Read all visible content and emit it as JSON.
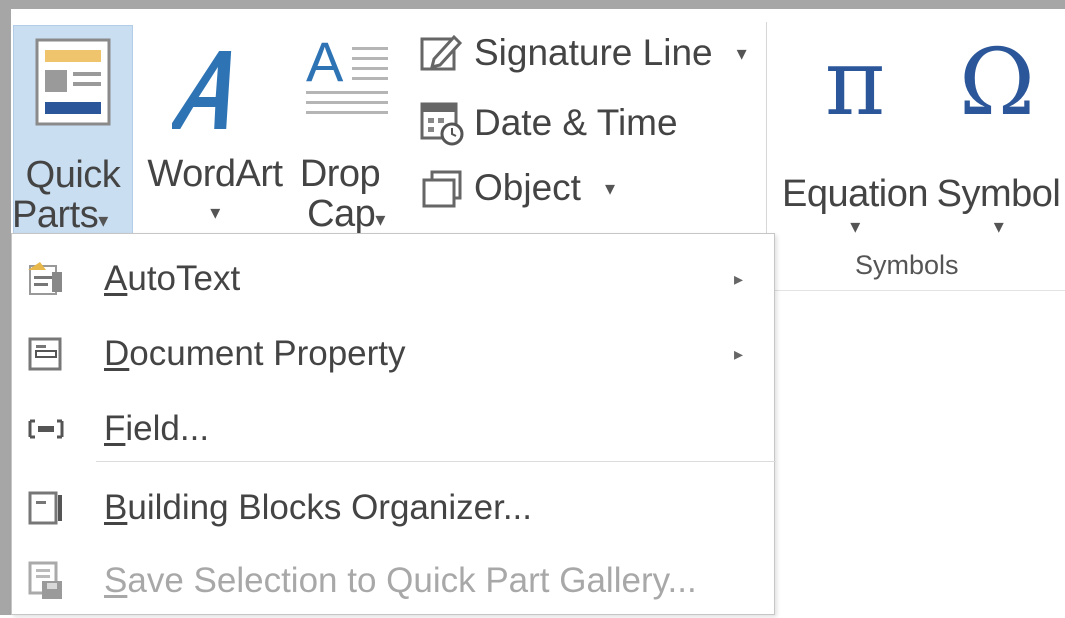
{
  "ribbon": {
    "quick_parts": {
      "line1": "Quick",
      "line2": "Parts",
      "arrow": "▾",
      "icon": "quick-parts-icon"
    },
    "wordart": {
      "line1": "WordArt",
      "arrow": "▾",
      "icon": "wordart-icon"
    },
    "drop_cap": {
      "line1": "Drop",
      "line2": "Cap",
      "arrow": "▾",
      "icon": "drop-cap-icon"
    },
    "signature_line": {
      "label": "Signature Line",
      "arrow": "▾",
      "icon": "signature-line-icon"
    },
    "date_time": {
      "label": "Date & Time",
      "icon": "date-time-icon"
    },
    "object": {
      "label": "Object",
      "arrow": "▾",
      "icon": "object-icon"
    },
    "equation": {
      "line1": "Equation",
      "arrow": "▾",
      "glyph": "π",
      "icon": "pi-icon"
    },
    "symbol": {
      "line1": "Symbol",
      "arrow": "▾",
      "glyph": "Ω",
      "icon": "omega-icon"
    },
    "group_symbols": "Symbols"
  },
  "menu": {
    "items": [
      {
        "label_first": "A",
        "label_rest": "utoText",
        "submenu": "▸",
        "icon": "autotext-icon",
        "enabled": true
      },
      {
        "label_first": "D",
        "label_rest": "ocument Property",
        "submenu": "▸",
        "icon": "document-property-icon",
        "enabled": true
      },
      {
        "label_first": "F",
        "label_rest": "ield...",
        "icon": "field-icon",
        "enabled": true
      },
      {
        "label_first": "B",
        "label_rest": "uilding Blocks Organizer...",
        "icon": "building-blocks-icon",
        "enabled": true
      },
      {
        "label_first": "S",
        "label_rest": "ave Selection to Quick Part Gallery...",
        "icon": "save-selection-icon",
        "enabled": false
      }
    ]
  },
  "colors": {
    "accent": "#2b579a",
    "pressed_bg": "#c9def1",
    "wordart_blue": "#2e74b5",
    "disabled_text": "#a8a8a8"
  }
}
